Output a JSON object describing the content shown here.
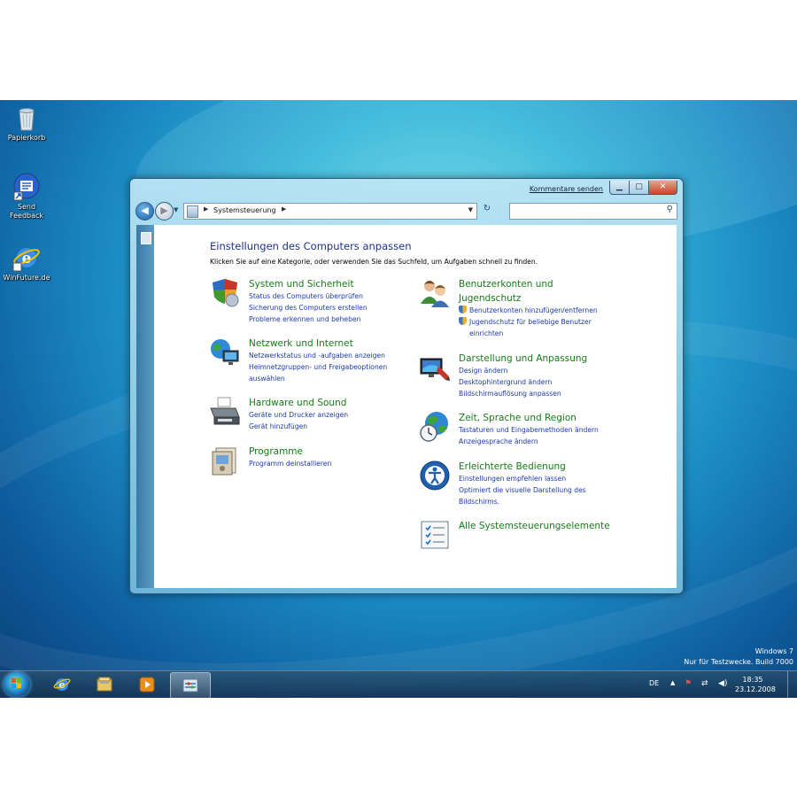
{
  "desktop": {
    "icons": [
      {
        "label": "Papierkorb"
      },
      {
        "label": "Send Feedback"
      },
      {
        "label": "WinFuture.de"
      }
    ],
    "watermark": {
      "line1": "Windows 7",
      "line2": "Nur für Testzwecke. Build 7000"
    }
  },
  "window": {
    "feedback_link": "Kommentare senden",
    "address": {
      "path": "Systemsteuerung"
    },
    "search": {
      "placeholder": ""
    },
    "title": "Einstellungen des Computers anpassen",
    "subtitle": "Klicken Sie auf eine Kategorie, oder verwenden Sie das Suchfeld, um Aufgaben schnell zu finden.",
    "left_categories": [
      {
        "title": "System und Sicherheit",
        "icon": "shield-icon",
        "links": [
          "Status des Computers überprüfen",
          "Sicherung des Computers erstellen",
          "Probleme erkennen und beheben"
        ]
      },
      {
        "title": "Netzwerk und Internet",
        "icon": "network-globe-icon",
        "links": [
          "Netzwerkstatus und -aufgaben anzeigen",
          "Heimnetzgruppen- und Freigabeoptionen",
          "auswählen"
        ]
      },
      {
        "title": "Hardware und Sound",
        "icon": "printer-icon",
        "links": [
          "Geräte und Drucker anzeigen",
          "Gerät hinzufügen"
        ]
      },
      {
        "title": "Programme",
        "icon": "programs-icon",
        "links": [
          "Programm deinstallieren"
        ]
      }
    ],
    "right_categories": [
      {
        "title_line1": "Benutzerkonten und",
        "title_line2": "Jugendschutz",
        "icon": "users-icon",
        "links": [
          "Benutzerkonten hinzufügen/entfernen",
          "Jugendschutz für beliebige Benutzer",
          "einrichten"
        ]
      },
      {
        "title": "Darstellung und Anpassung",
        "icon": "display-icon",
        "links": [
          "Design ändern",
          "Desktophintergrund ändern",
          "Bildschirmauflösung anpassen"
        ]
      },
      {
        "title": "Zeit, Sprache und Region",
        "icon": "clock-globe-icon",
        "links": [
          "Tastaturen und Eingabemethoden ändern",
          "Anzeigesprache ändern"
        ]
      },
      {
        "title": "Erleichterte Bedienung",
        "icon": "accessibility-icon",
        "links": [
          "Einstellungen empfehlen lassen",
          "Optimiert die visuelle Darstellung des",
          "Bildschirms."
        ]
      },
      {
        "title": "Alle Systemsteuerungselemente",
        "icon": "checklist-icon",
        "links": []
      }
    ]
  },
  "taskbar": {
    "language": "DE",
    "time": "18:35",
    "date": "23.12.2008"
  },
  "colors": {
    "category_title": "#147d14",
    "link": "#1c3aa9",
    "heading": "#1e3287"
  }
}
